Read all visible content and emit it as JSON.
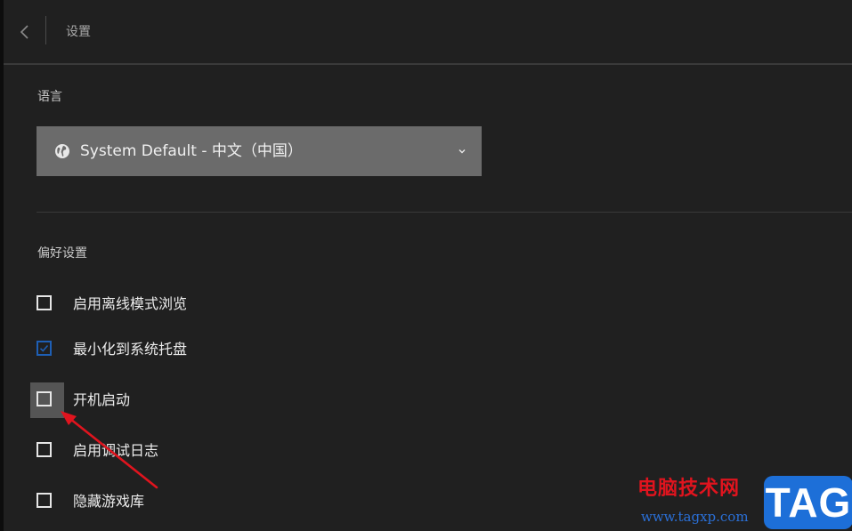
{
  "header": {
    "title": "设置",
    "back_icon": "chevron-left-icon"
  },
  "language": {
    "label": "语言",
    "selected": "System Default - 中文（中国）",
    "globe_icon": "globe-icon",
    "chevron_icon": "chevron-down-icon"
  },
  "preferences": {
    "label": "偏好设置",
    "options": [
      {
        "label": "启用离线模式浏览",
        "checked": false
      },
      {
        "label": "最小化到系统托盘",
        "checked": true
      },
      {
        "label": "开机启动",
        "checked": false,
        "hovered": true
      },
      {
        "label": "启用调试日志",
        "checked": false
      },
      {
        "label": "隐藏游戏库",
        "checked": false
      }
    ]
  },
  "colors": {
    "background": "#202020",
    "select_bg": "#6b6b6b",
    "checkbox_checked": "#1e5fb5",
    "annotation_arrow": "#e0141e"
  },
  "watermark": {
    "site_name": "电脑技术网",
    "url": "www.tagxp.com",
    "badge": "TAG"
  }
}
